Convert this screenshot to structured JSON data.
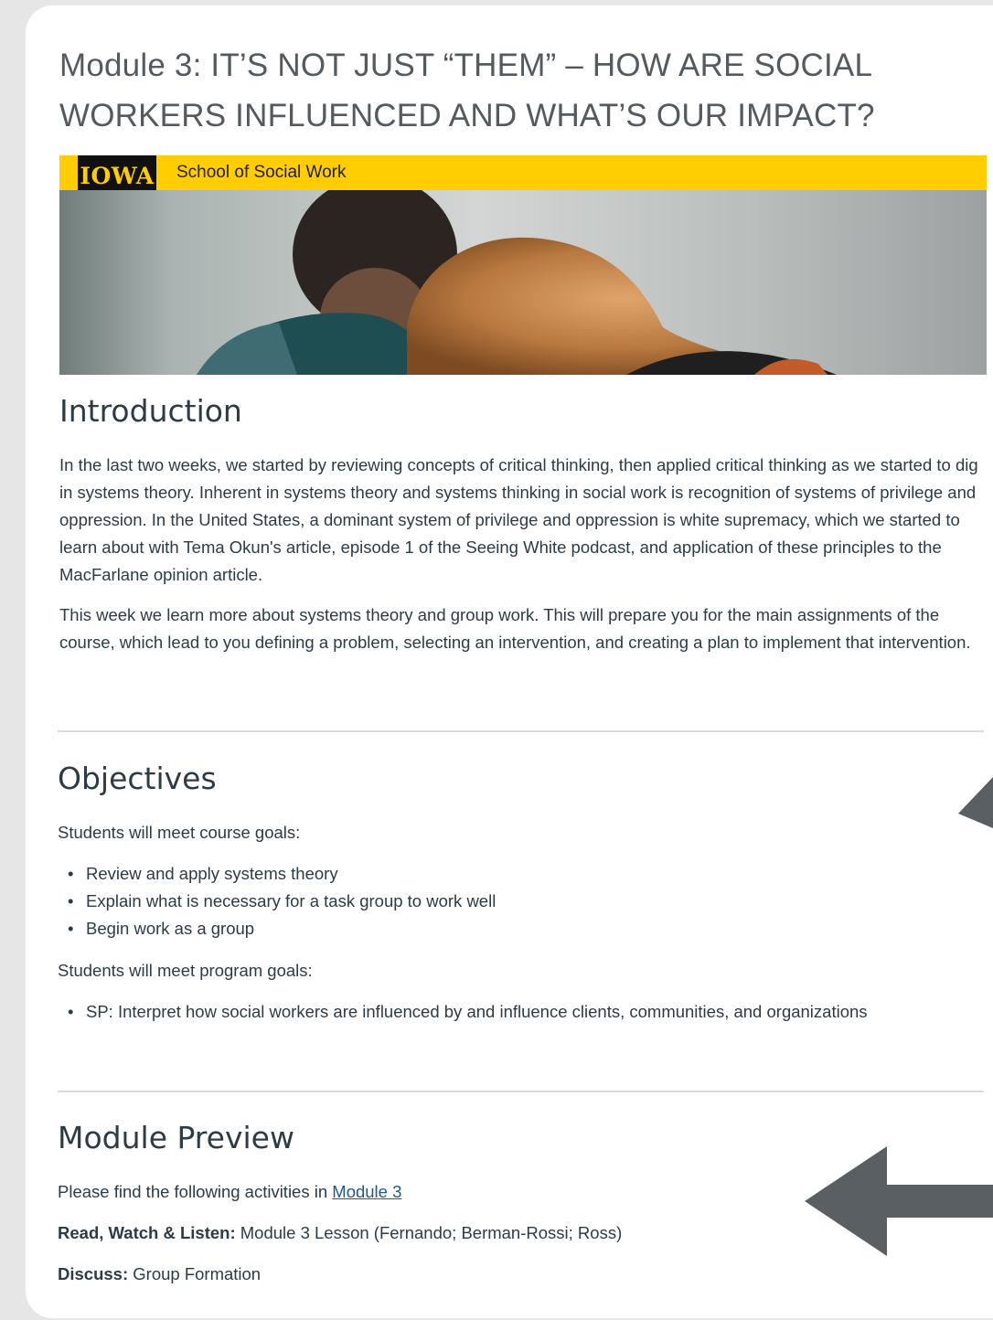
{
  "module_title": "Module 3: IT’S NOT JUST “THEM” – HOW ARE SOCIAL WORKERS INFLUENCED AND WHAT’S OUR IMPACT?",
  "banner": {
    "logo_text": "IOWA",
    "school_name": "School of Social Work",
    "bar_color": "#ffcd00"
  },
  "introduction": {
    "heading": "Introduction",
    "paragraphs": [
      "In the last two weeks, we started by reviewing concepts of critical thinking, then applied critical thinking as we started to dig in systems theory. Inherent in systems theory and systems thinking in social work is recognition of systems of privilege and oppression. In the United States, a dominant system of privilege and oppression is white supremacy, which we started to learn about with Tema Okun's article, episode 1 of the Seeing White podcast, and application of these principles to the MacFarlane opinion article.",
      "This week we learn more about systems theory and group work. This will prepare you for the main assignments of the course, which lead to you defining a problem, selecting an intervention, and creating a plan to implement that intervention."
    ]
  },
  "objectives": {
    "heading": "Objectives",
    "course_intro": "Students will meet course goals:",
    "course_goals": [
      "Review and apply systems theory",
      "Explain what is necessary for a task group to work well",
      "Begin work as a group"
    ],
    "program_intro": "Students will meet program goals:",
    "program_goals": [
      "SP: Interpret how social workers are influenced by and influence clients, communities, and organizations"
    ]
  },
  "module_preview": {
    "heading": "Module Preview",
    "intro": "Please find the following activities in ",
    "link_text": "Module 3",
    "read_label": "Read, Watch & Listen:",
    "read_value": " Module 3 Lesson (Fernando; Berman-Rossi; Ross)",
    "discuss_label": "Discuss:",
    "discuss_value": " Group Formation"
  },
  "arrow_color": "#5a5f64"
}
